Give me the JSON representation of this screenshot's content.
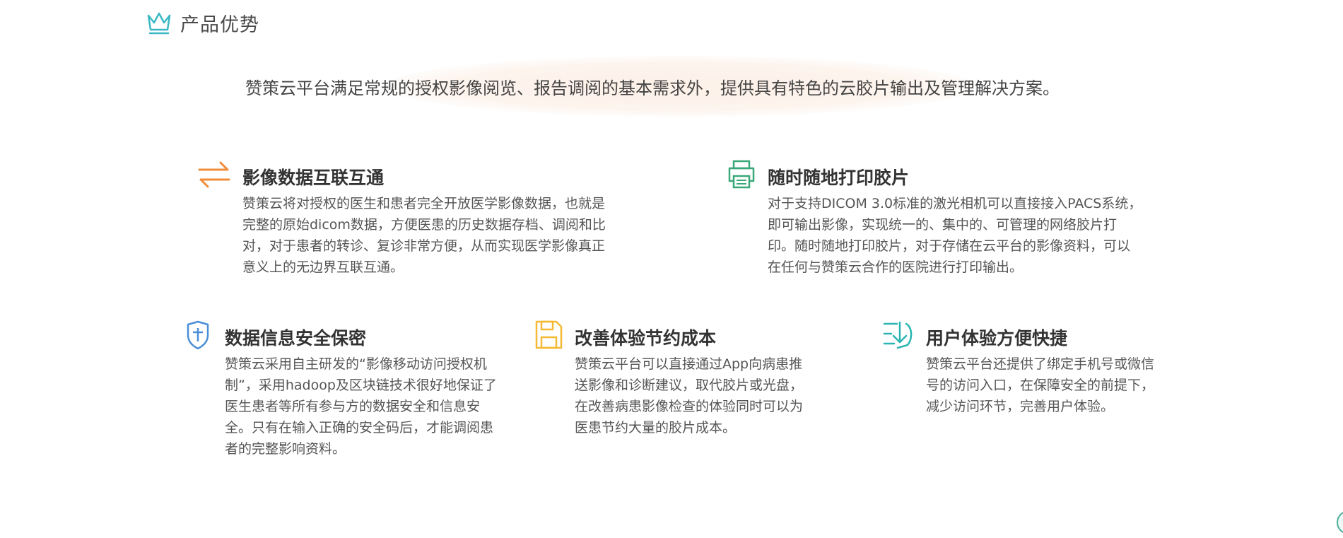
{
  "section": {
    "title": "产品优势",
    "icon": "crown-icon",
    "accent_color": "#39b8c3"
  },
  "intro": {
    "text": "赞策云平台满足常规的授权影像阅览、报告调阅的基本需求外，提供具有特色的云胶片输出及管理解决方案。"
  },
  "features": [
    {
      "icon": "transfer-arrows-icon",
      "icon_color": "#f08c3a",
      "title": "影像数据互联互通",
      "description": "赞策云将对授权的医生和患者完全开放医学影像数据，也就是完整的原始dicom数据，方便医患的历史数据存档、调阅和比对，对于患者的转诊、复诊非常方便，从而实现医学影像真正意义上的无边界互联互通。"
    },
    {
      "icon": "printer-icon",
      "icon_color": "#3aa878",
      "title": "随时随地打印胶片",
      "description": "对于支持DICOM 3.0标准的激光相机可以直接接入PACS系统，即可输出影像，实现统一的、集中的、可管理的网络胶片打印。随时随地打印胶片，对于存储在云平台的影像资料，可以在任何与赞策云合作的医院进行打印输出。"
    },
    {
      "icon": "shield-icon",
      "icon_color": "#4a8fd6",
      "title": "数据信息安全保密",
      "description": "赞策云采用自主研发的“影像移动访问授权机制”，采用hadoop及区块链技术很好地保证了医生患者等所有参与方的数据安全和信息安全。只有在输入正确的安全码后，才能调阅患者的完整影响资料。"
    },
    {
      "icon": "save-disk-icon",
      "icon_color": "#f5b935",
      "title": "改善体验节约成本",
      "description": "赞策云平台可以直接通过App向病患推送影像和诊断建议，取代胶片或光盘，在改善病患影像检查的体验同时可以为医患节约大量的胶片成本。"
    },
    {
      "icon": "list-download-icon",
      "icon_color": "#2bb5b2",
      "title": "用户体验方便快捷",
      "description": "赞策云平台还提供了绑定手机号或微信号的访问入口，在保障安全的前提下，减少访问环节，完善用户体验。"
    }
  ]
}
